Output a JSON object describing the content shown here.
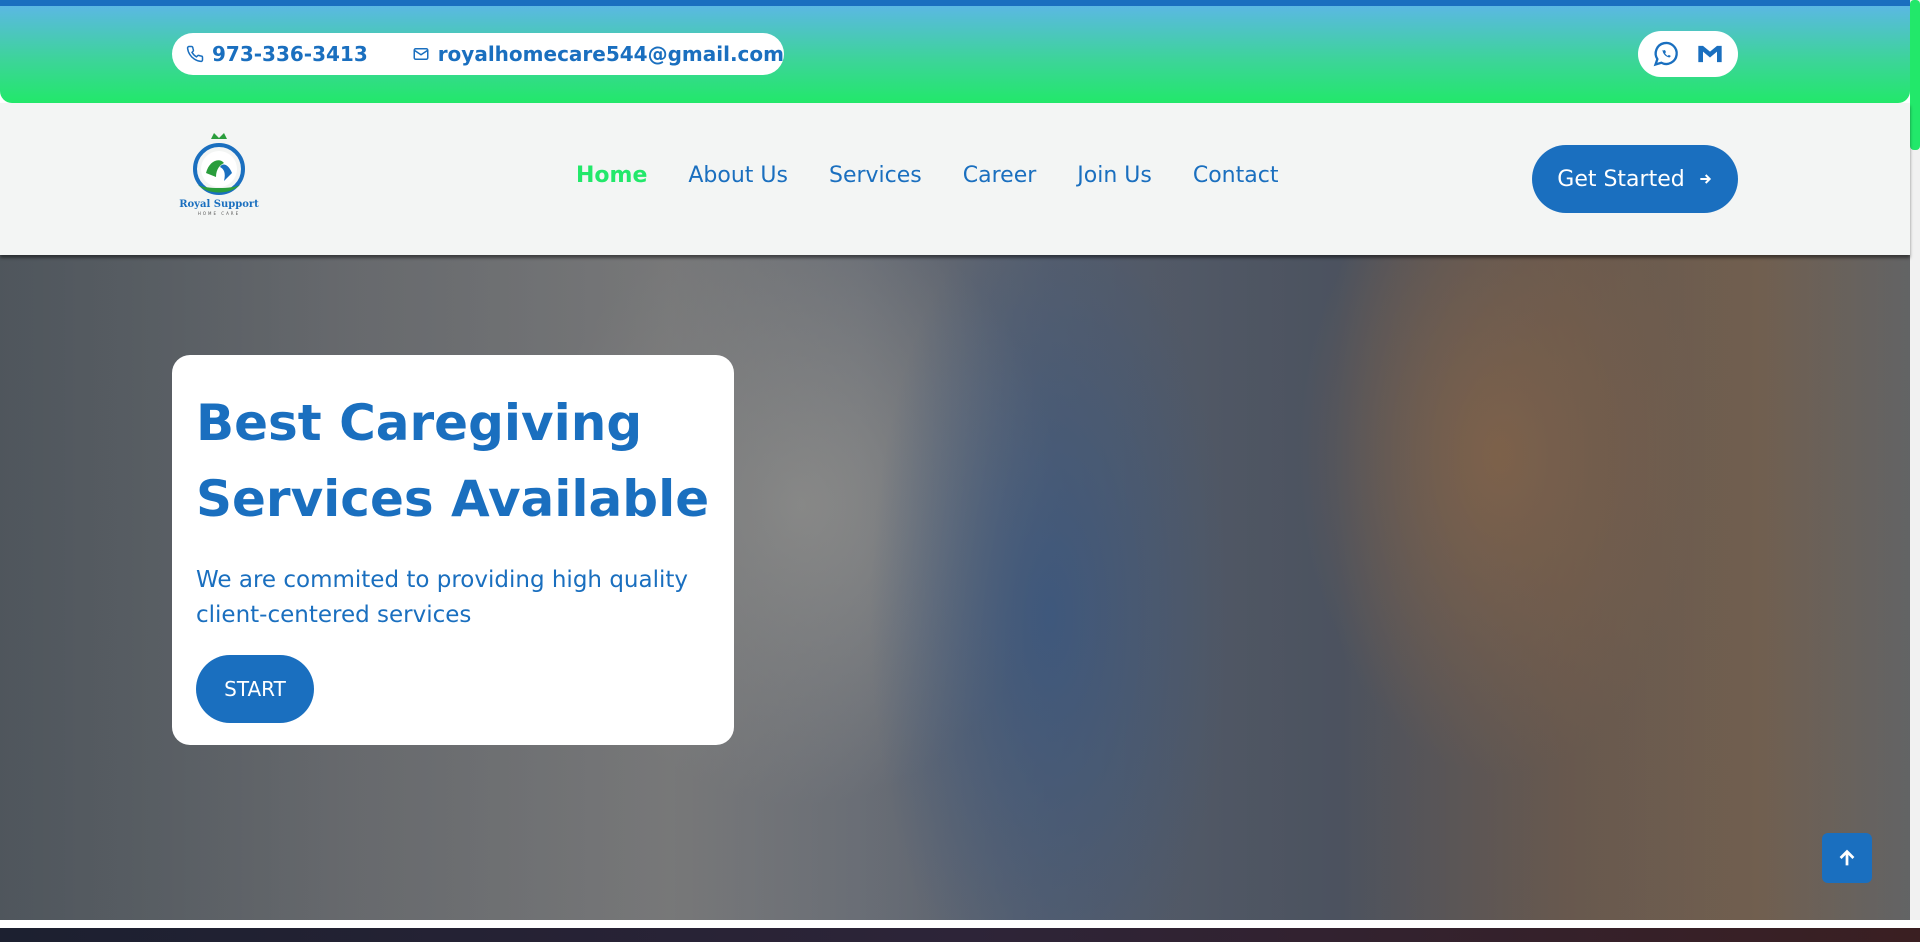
{
  "topbar": {
    "phone": "973-336-3413",
    "email": "royalhomecare544@gmail.com",
    "social": [
      "whatsapp-icon",
      "gmail-icon"
    ]
  },
  "logo": {
    "name": "Royal Support",
    "sub": "HOME CARE"
  },
  "nav": {
    "items": [
      {
        "label": "Home",
        "active": true
      },
      {
        "label": "About Us"
      },
      {
        "label": "Services"
      },
      {
        "label": "Career"
      },
      {
        "label": "Join Us"
      },
      {
        "label": "Contact"
      }
    ],
    "cta": "Get Started"
  },
  "hero": {
    "title": "Best Caregiving Services Available",
    "subtitle": "We are commited to providing high quality client-centered services",
    "button": "START"
  },
  "colors": {
    "primary": "#1a6fbf",
    "accent": "#22e86a"
  }
}
